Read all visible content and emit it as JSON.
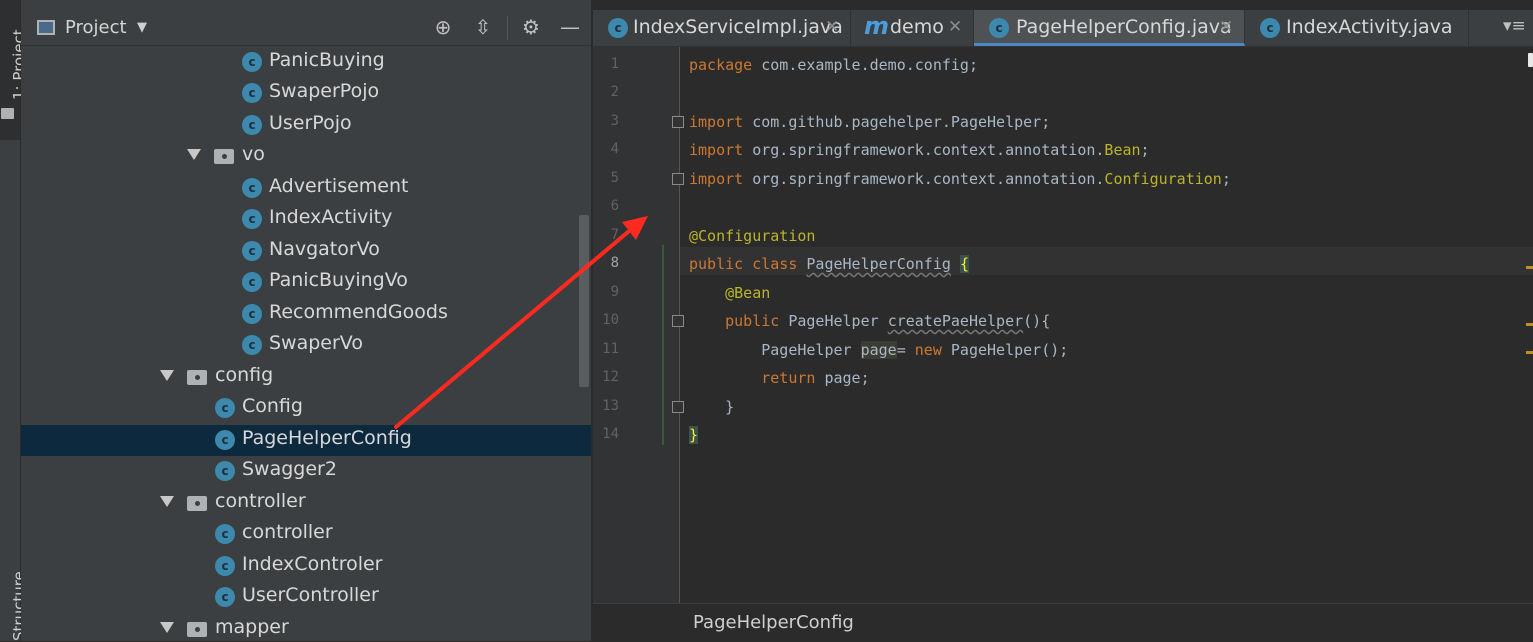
{
  "side_strip": {
    "project_label": "1: Project",
    "structure_label": "Structure"
  },
  "project_panel": {
    "title": "Project",
    "tree": [
      {
        "label": "PanicBuying",
        "type": "class"
      },
      {
        "label": "SwaperPojo",
        "type": "class"
      },
      {
        "label": "UserPojo",
        "type": "class"
      },
      {
        "label": "vo",
        "type": "package",
        "expanded": true
      },
      {
        "label": "Advertisement",
        "type": "class"
      },
      {
        "label": "IndexActivity",
        "type": "class"
      },
      {
        "label": "NavgatorVo",
        "type": "class"
      },
      {
        "label": "PanicBuyingVo",
        "type": "class"
      },
      {
        "label": "RecommendGoods",
        "type": "class"
      },
      {
        "label": "SwaperVo",
        "type": "class"
      },
      {
        "label": "config",
        "type": "package",
        "expanded": true
      },
      {
        "label": "Config",
        "type": "class"
      },
      {
        "label": "PageHelperConfig",
        "type": "class",
        "selected": true
      },
      {
        "label": "Swagger2",
        "type": "class"
      },
      {
        "label": "controller",
        "type": "package",
        "expanded": true
      },
      {
        "label": "controller",
        "type": "class"
      },
      {
        "label": "IndexControler",
        "type": "class"
      },
      {
        "label": "UserController",
        "type": "class"
      },
      {
        "label": "mapper",
        "type": "package",
        "expanded": true
      }
    ]
  },
  "tabs": [
    {
      "label": "IndexServiceImpl.java",
      "icon": "class-icon",
      "active": false
    },
    {
      "label": "demo",
      "icon": "maven-icon",
      "active": false
    },
    {
      "label": "PageHelperConfig.java",
      "icon": "class-icon",
      "active": true
    },
    {
      "label": "IndexActivity.java",
      "icon": "class-icon",
      "active": false
    }
  ],
  "editor": {
    "line_numbers": [
      "1",
      "2",
      "3",
      "4",
      "5",
      "6",
      "7",
      "8",
      "9",
      "10",
      "11",
      "12",
      "13",
      "14"
    ],
    "current_line": 8,
    "code": {
      "l1_kw": "package",
      "l1_rest": " com.example.demo.config;",
      "l3_kw": "import",
      "l3_rest": " com.github.pagehelper.PageHelper;",
      "l4_kw": "import",
      "l4_rest": " org.springframework.context.annotation.",
      "l4_cls": "Bean",
      "l4_end": ";",
      "l5_kw": "import",
      "l5_rest": " org.springframework.context.annotation.",
      "l5_cls": "Configuration",
      "l5_end": ";",
      "l7_ann": "@Configuration",
      "l8_kw": "public class ",
      "l8_name": "PageHelperConfig",
      "l8_brace": "{",
      "l9_ann": "@Bean",
      "l10_kw": "public ",
      "l10_type": "PageHelper ",
      "l10_name": "createPaeHelper",
      "l10_end": "(){",
      "l11_type": "PageHelper ",
      "l11_var": "page",
      "l11_eq": "= ",
      "l11_kw": "new ",
      "l11_end": "PageHelper();",
      "l12_kw": "return ",
      "l12_end": "page;",
      "l13": "}",
      "l14": "}"
    }
  },
  "breadcrumb": "PageHelperConfig",
  "colors": {
    "annotation_arrow": "#ff2a1f",
    "selection": "#0d293e",
    "active_tab_underline": "#4a88c7"
  }
}
